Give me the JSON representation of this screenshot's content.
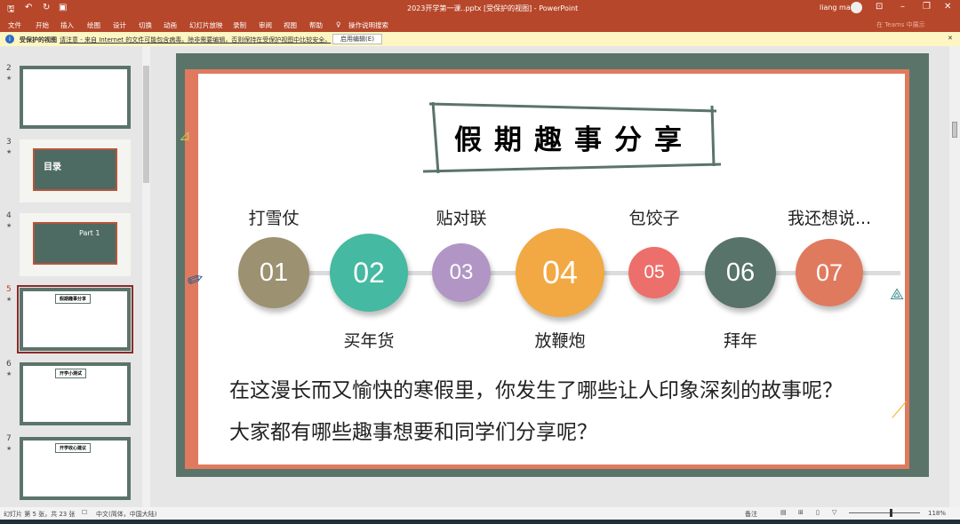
{
  "window": {
    "title": "2023开学第一课..pptx [受保护的视图]  -  PowerPoint",
    "user": "liang ma",
    "teams": "在 Teams 中展示"
  },
  "ribbon": {
    "tabs": [
      "文件",
      "开始",
      "插入",
      "绘图",
      "设计",
      "切换",
      "动画",
      "幻灯片放映",
      "录制",
      "审阅",
      "视图",
      "帮助"
    ],
    "search": "操作说明搜索"
  },
  "protected_bar": {
    "label": "受保护的视图",
    "message": "请注意 - 来自 Internet 的文件可能包含病毒。除非需要编辑，否则保持在受保护视图中比较安全。",
    "button": "启用编辑(E)"
  },
  "thumbnails": [
    {
      "num": "2",
      "title": ""
    },
    {
      "num": "3",
      "title": "目录"
    },
    {
      "num": "4",
      "title": "Part 1"
    },
    {
      "num": "5",
      "title": "假期趣事分享",
      "selected": true
    },
    {
      "num": "6",
      "title": "开学小测试"
    },
    {
      "num": "7",
      "title": "开学收心建议"
    }
  ],
  "slide": {
    "title": "假期趣事分享",
    "items": [
      {
        "num": "01",
        "label": "打雪仗",
        "pos": "top",
        "color": "#9c9170"
      },
      {
        "num": "02",
        "label": "买年货",
        "pos": "bottom",
        "color": "#45b9a1"
      },
      {
        "num": "03",
        "label": "贴对联",
        "pos": "top",
        "color": "#b196c5"
      },
      {
        "num": "04",
        "label": "放鞭炮",
        "pos": "bottom",
        "color": "#f2a843"
      },
      {
        "num": "05",
        "label": "包饺子",
        "pos": "top",
        "color": "#ec6f6b"
      },
      {
        "num": "06",
        "label": "拜年",
        "pos": "bottom",
        "color": "#58736a"
      },
      {
        "num": "07",
        "label": "我还想说...",
        "pos": "top",
        "color": "#e07a5f"
      }
    ],
    "body": [
      "在这漫长而又愉快的寒假里，你发生了哪些让人印象深刻的故事呢？",
      "大家都有哪些趣事想要和同学们分享呢？"
    ],
    "frame_color": "#5b7469",
    "border_color": "#e07a5f"
  },
  "status": {
    "slide": "幻灯片 第 5 张，共 23 张",
    "lang": "中文(简体，中国大陆)",
    "notes": "备注",
    "zoom": "118%"
  }
}
